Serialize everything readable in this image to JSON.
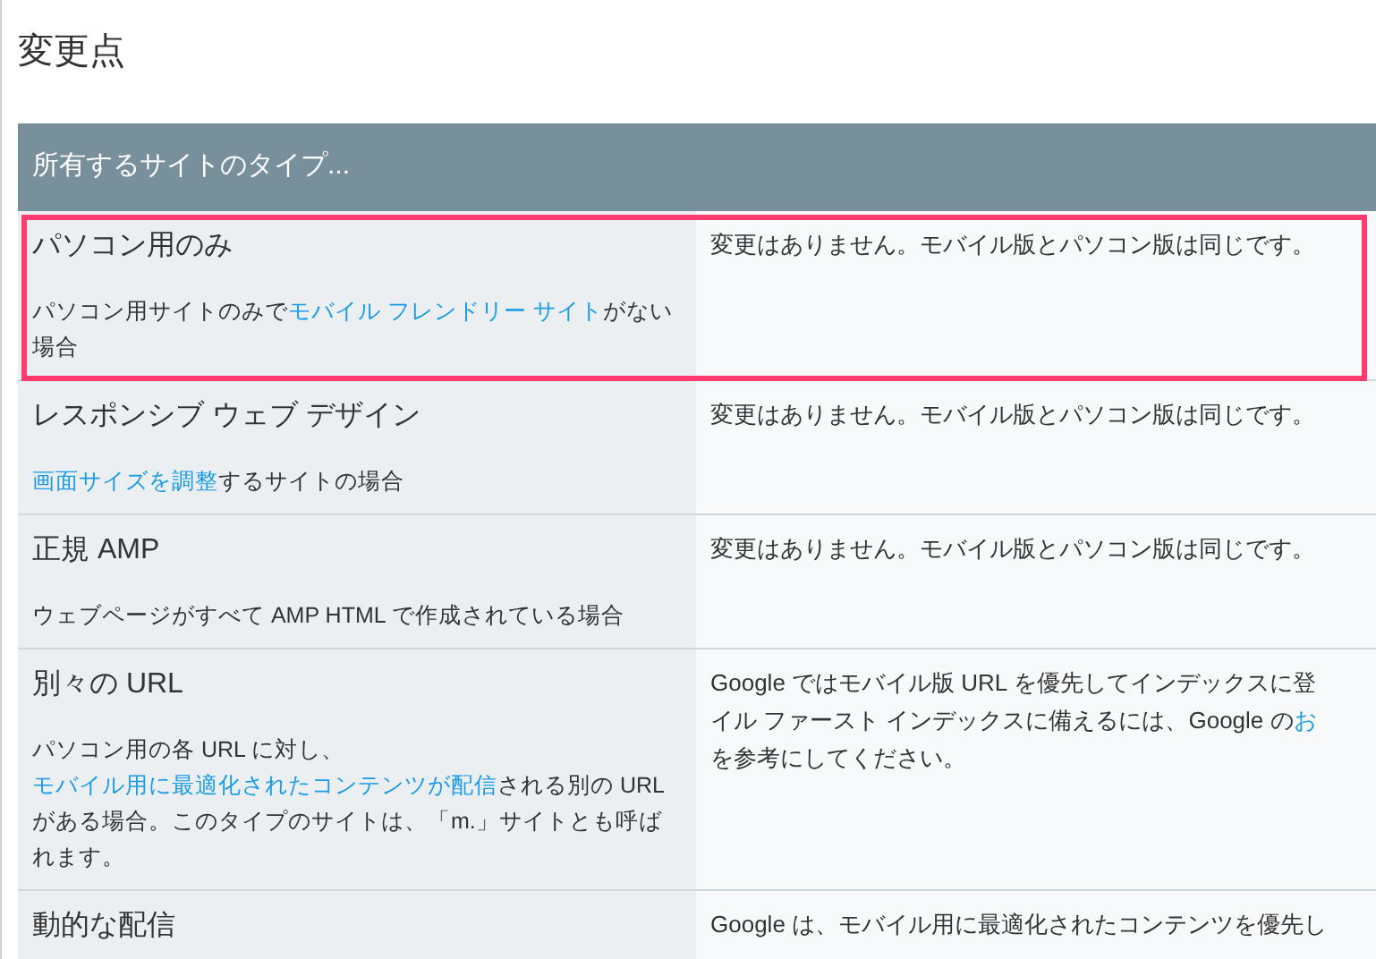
{
  "page_title": "変更点",
  "table": {
    "header": "所有するサイトのタイプ...",
    "rows": [
      {
        "highlighted": true,
        "title": "パソコン用のみ",
        "description": [
          {
            "text": "パソコン用サイトのみで",
            "link": false
          },
          {
            "text": "モバイル フレンドリー サイト",
            "link": true
          },
          {
            "text": "がない場合",
            "link": false
          }
        ],
        "change": [
          [
            {
              "text": "変更はありません。モバイル版とパソコン版は同じです。",
              "link": false
            }
          ]
        ]
      },
      {
        "highlighted": false,
        "title": "レスポンシブ ウェブ デザイン",
        "description": [
          {
            "text": "画面サイズを調整",
            "link": true
          },
          {
            "text": "するサイトの場合",
            "link": false
          }
        ],
        "change": [
          [
            {
              "text": "変更はありません。モバイル版とパソコン版は同じです。",
              "link": false
            }
          ]
        ]
      },
      {
        "highlighted": false,
        "title": "正規 AMP",
        "description": [
          {
            "text": "ウェブページがすべて AMP HTML で作成されている場合",
            "link": false
          }
        ],
        "change": [
          [
            {
              "text": "変更はありません。モバイル版とパソコン版は同じです。",
              "link": false
            }
          ]
        ]
      },
      {
        "highlighted": false,
        "title": "別々の URL",
        "description": [
          {
            "text": "パソコン用の各 URL に対し、",
            "link": false
          },
          {
            "text": "モバイル用に最適化されたコンテンツが配信",
            "link": true
          },
          {
            "text": "される別の URL がある場合。このタイプのサイトは、「m.」サイトとも呼ばれます。",
            "link": false
          }
        ],
        "change": [
          [
            {
              "text": "Google ではモバイル版 URL を優先してインデックスに登",
              "link": false
            }
          ],
          [
            {
              "text": "イル ファースト インデックスに備えるには、Google の",
              "link": false
            },
            {
              "text": "お",
              "link": true
            }
          ],
          [
            {
              "text": "を参考にしてください。",
              "link": false
            }
          ]
        ]
      },
      {
        "highlighted": false,
        "title": "動的な配信",
        "description": [],
        "change": [
          [
            {
              "text": "Google は、モバイル用に最適化されたコンテンツを優先し",
              "link": false
            }
          ]
        ]
      }
    ]
  }
}
